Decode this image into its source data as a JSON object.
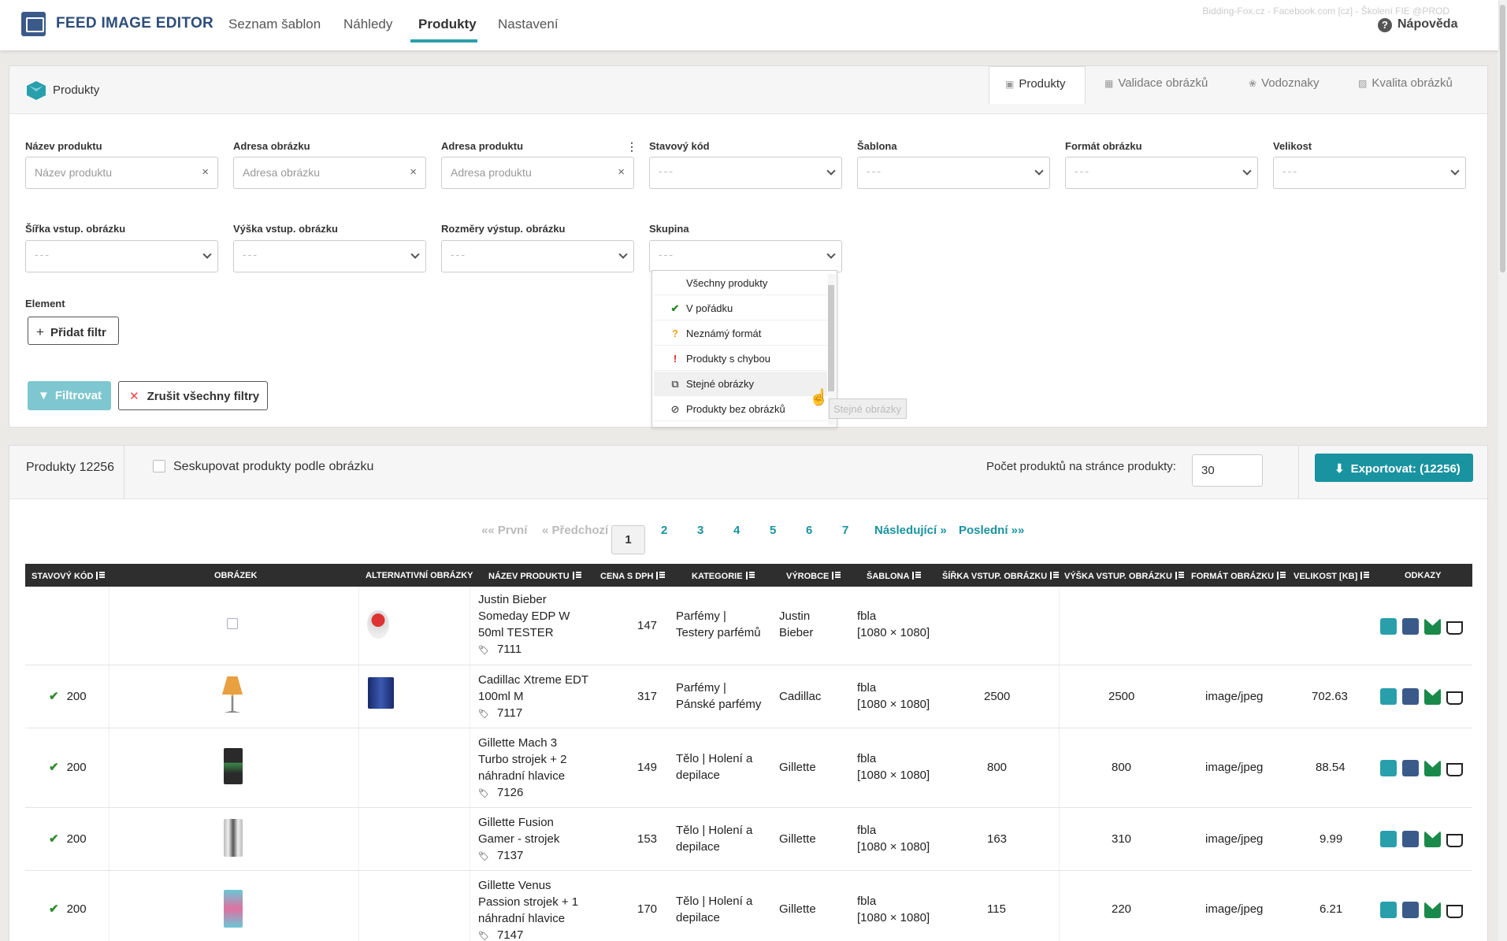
{
  "app": {
    "brand": "FEED IMAGE EDITOR",
    "account_info": "Bidding-Fox.cz - Facebook.com [cz] - Školení FIE @PROD",
    "help_label": "Nápověda"
  },
  "nav": {
    "items": [
      "Seznam šablon",
      "Náhledy",
      "Produkty",
      "Nastavení"
    ],
    "active": "Produkty"
  },
  "panel": {
    "title": "Produkty",
    "tabs": [
      "Produkty",
      "Validace obrázků",
      "Vodoznaky",
      "Kvalita obrázků"
    ],
    "active_tab": "Produkty"
  },
  "filters": {
    "name": {
      "label": "Název produktu",
      "placeholder": "Název produktu"
    },
    "image_url": {
      "label": "Adresa obrázku",
      "placeholder": "Adresa obrázku"
    },
    "product_url": {
      "label": "Adresa produktu",
      "placeholder": "Adresa produktu"
    },
    "status_code": {
      "label": "Stavový kód",
      "value": "---"
    },
    "template": {
      "label": "Šablona",
      "value": "---"
    },
    "format": {
      "label": "Formát obrázku",
      "value": "---"
    },
    "size": {
      "label": "Velikost",
      "value": "---"
    },
    "in_width": {
      "label": "Šířka vstup. obrázku",
      "value": "---"
    },
    "in_height": {
      "label": "Výška vstup. obrázku",
      "value": "---"
    },
    "out_dims": {
      "label": "Rozměry výstup. obrázku",
      "value": "---"
    },
    "group": {
      "label": "Skupina",
      "value": "---"
    },
    "element_label": "Element",
    "add_filter": "Přidat filtr",
    "apply": "Filtrovat",
    "clear_all": "Zrušit všechny filtry"
  },
  "group_dropdown": {
    "options": [
      {
        "label": "Všechny produkty",
        "icon": "none"
      },
      {
        "label": "V pořádku",
        "icon": "check-icon"
      },
      {
        "label": "Neznámý formát",
        "icon": "question-icon"
      },
      {
        "label": "Produkty s chybou",
        "icon": "exclamation-icon"
      },
      {
        "label": "Stejné obrázky",
        "icon": "copy-icon"
      },
      {
        "label": "Produkty bez obrázků",
        "icon": "eye-slash-icon"
      }
    ],
    "highlighted": "Stejné obrázky",
    "tooltip": "Stejné obrázky"
  },
  "products": {
    "count_label": "Produkty 12256",
    "group_checkbox_label": "Seskupovat produkty podle obrázku",
    "per_page_label": "Počet produktů na stránce produkty:",
    "per_page_value": "30",
    "export_label": "Exportovat: (12256)"
  },
  "pagination": {
    "first": "«« První",
    "prev": "« Předchozí",
    "pages": [
      "1",
      "2",
      "3",
      "4",
      "5",
      "6",
      "7"
    ],
    "current": "1",
    "next": "Následující »",
    "last": "Poslední »»"
  },
  "table": {
    "headers": [
      "STAVOVÝ KÓD",
      "OBRÁZEK",
      "ALTERNATIVNÍ OBRÁZKY",
      "NÁZEV PRODUKTU",
      "CENA S DPH",
      "KATEGORIE",
      "VÝROBCE",
      "ŠABLONA",
      "ŠÍŘKA VSTUP. OBRÁZKU",
      "VÝŠKA VSTUP. OBRÁZKU",
      "FORMÁT OBRÁZKU",
      "VELIKOST [KB]",
      "ODKAZY"
    ],
    "rows": [
      {
        "status": "",
        "name_lines": [
          "Justin Bieber",
          "Someday EDP W",
          "50ml TESTER"
        ],
        "id": "7111",
        "price": "147",
        "category_lines": [
          "Parfémy |",
          "Testery parfémů"
        ],
        "maker_lines": [
          "Justin",
          "Bieber"
        ],
        "template_lines": [
          "fbla",
          "[1080 × 1080]"
        ],
        "width": "",
        "height": "",
        "format": "",
        "size": ""
      },
      {
        "status": "200",
        "name_lines": [
          "Cadillac Xtreme EDT",
          "100ml M"
        ],
        "id": "7117",
        "price": "317",
        "category_lines": [
          "Parfémy |",
          "Pánské parfémy"
        ],
        "maker_lines": [
          "Cadillac"
        ],
        "template_lines": [
          "fbla",
          "[1080 × 1080]"
        ],
        "width": "2500",
        "height": "2500",
        "format": "image/jpeg",
        "size": "702.63"
      },
      {
        "status": "200",
        "name_lines": [
          "Gillette Mach 3",
          "Turbo strojek + 2",
          "náhradní hlavice"
        ],
        "id": "7126",
        "price": "149",
        "category_lines": [
          "Tělo | Holení a",
          "depilace"
        ],
        "maker_lines": [
          "Gillette"
        ],
        "template_lines": [
          "fbla",
          "[1080 × 1080]"
        ],
        "width": "800",
        "height": "800",
        "format": "image/jpeg",
        "size": "88.54"
      },
      {
        "status": "200",
        "name_lines": [
          "Gillette Fusion",
          "Gamer - strojek"
        ],
        "id": "7137",
        "price": "153",
        "category_lines": [
          "Tělo | Holení a",
          "depilace"
        ],
        "maker_lines": [
          "Gillette"
        ],
        "template_lines": [
          "fbla",
          "[1080 × 1080]"
        ],
        "width": "163",
        "height": "310",
        "format": "image/jpeg",
        "size": "9.99"
      },
      {
        "status": "200",
        "name_lines": [
          "Gillette Venus",
          "Passion strojek + 1",
          "náhradní hlavice"
        ],
        "id": "7147",
        "price": "170",
        "category_lines": [
          "Tělo | Holení a",
          "depilace"
        ],
        "maker_lines": [
          "Gillette"
        ],
        "template_lines": [
          "fbla",
          "[1080 × 1080]"
        ],
        "width": "115",
        "height": "220",
        "format": "image/jpeg",
        "size": "6.21"
      }
    ]
  },
  "colors": {
    "accent": "#1a93a0",
    "brand": "#2e4d7b",
    "ok": "#2e8b2e"
  }
}
